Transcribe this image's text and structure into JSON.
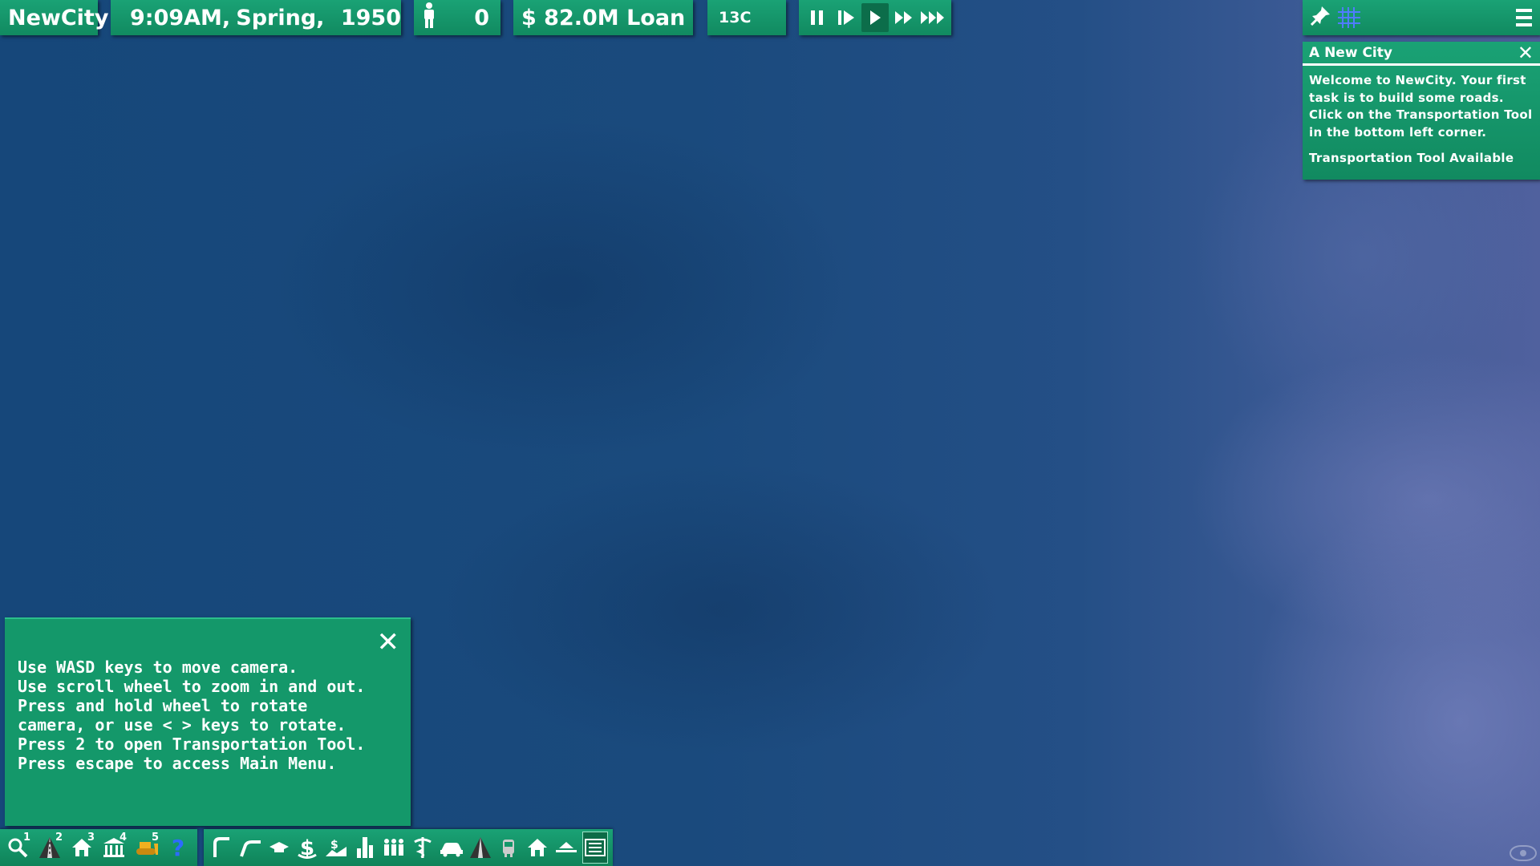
{
  "hud": {
    "city_name": "NewCity",
    "time": "9:09AM,",
    "season": "Spring,",
    "year": "1950",
    "population": "0",
    "money": "$ 82.0M Loan",
    "temperature": "13C"
  },
  "speed_controls": [
    "pause",
    "step",
    "play",
    "fast",
    "fastest"
  ],
  "notification": {
    "title": "A New City",
    "body": "Welcome to NewCity. Your first task is to build some roads. Click on the Transportation Tool in the bottom left corner.",
    "footer": "Transportation Tool Available"
  },
  "help_panel": {
    "text": "Use WASD keys to move camera.\nUse scroll wheel to zoom in and out.\nPress and hold wheel to rotate\ncamera, or use < > keys to rotate.\nPress 2 to open Transportation Tool.\nPress escape to access Main Menu."
  },
  "toolbar_left": [
    {
      "icon": "query-tool-icon",
      "key": "1"
    },
    {
      "icon": "transportation-tool-icon",
      "key": "2"
    },
    {
      "icon": "zoning-tool-icon",
      "key": "3"
    },
    {
      "icon": "amenities-tool-icon",
      "key": "4"
    },
    {
      "icon": "bulldozer-tool-icon",
      "key": "5"
    },
    {
      "icon": "help-icon",
      "key": ""
    }
  ],
  "toolbar_right": [
    "road-icon",
    "expressway-icon",
    "education-icon",
    "budget-icon",
    "land-value-icon",
    "density-icon",
    "population-icon",
    "health-icon",
    "traffic-icon",
    "road-map-icon",
    "transit-icon",
    "housing-icon",
    "flood-icon",
    "news-icon"
  ]
}
